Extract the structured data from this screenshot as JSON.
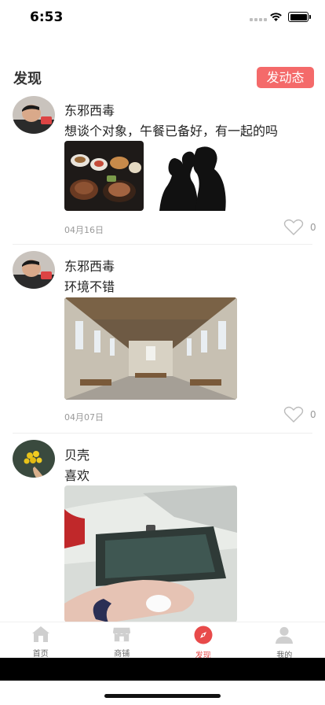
{
  "status": {
    "time": "6:53"
  },
  "header": {
    "title": "发现",
    "post_button": "发动态"
  },
  "posts": [
    {
      "username": "东邪西毒",
      "text": "想谈个对象，午餐已备好，有一起的吗",
      "date": "04月16日",
      "likes": "0"
    },
    {
      "username": "东邪西毒",
      "text": "环境不错",
      "date": "04月07日",
      "likes": "0"
    },
    {
      "username": "贝壳",
      "text": "喜欢",
      "date": "",
      "likes": ""
    }
  ],
  "tabs": [
    {
      "label": "首页",
      "icon": "home-icon",
      "active": false
    },
    {
      "label": "商铺",
      "icon": "shop-icon",
      "active": false
    },
    {
      "label": "发现",
      "icon": "compass-icon",
      "active": true
    },
    {
      "label": "我的",
      "icon": "user-icon",
      "active": false
    }
  ],
  "colors": {
    "accent": "#f46a6a",
    "active_tab": "#e84a4a"
  }
}
